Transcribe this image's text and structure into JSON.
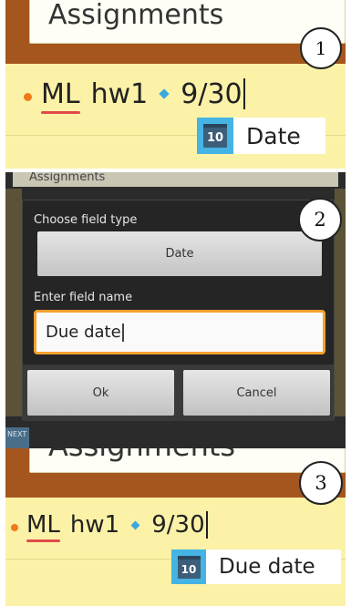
{
  "panel1": {
    "header_title": "Assignments",
    "step": "1",
    "note": {
      "word1": "ML",
      "word2": "hw1",
      "date": "9/30"
    },
    "chip": {
      "icon": "calendar-icon",
      "icon_number": "10",
      "label": "Date"
    }
  },
  "panel2": {
    "background_title": "Assignments",
    "step": "2",
    "dialog": {
      "type_label": "Choose field type",
      "type_value": "Date",
      "name_label": "Enter field name",
      "name_value": "Due date",
      "ok_label": "Ok",
      "cancel_label": "Cancel"
    },
    "next_label": "NEXT"
  },
  "panel3": {
    "header_title": "Assignments",
    "step": "3",
    "note": {
      "word1": "ML",
      "word2": "hw1",
      "date": "9/30"
    },
    "chip": {
      "icon": "calendar-icon",
      "icon_number": "10",
      "label": "Due date"
    }
  },
  "colors": {
    "paper": "#fbf2a8",
    "header_brown": "#a4561e",
    "bullet": "#f07a1a",
    "diamond": "#3aa9e0",
    "spell_underline": "#e04b4b",
    "calendar_frame": "#45b3e3",
    "input_focus": "#f5a12e"
  }
}
